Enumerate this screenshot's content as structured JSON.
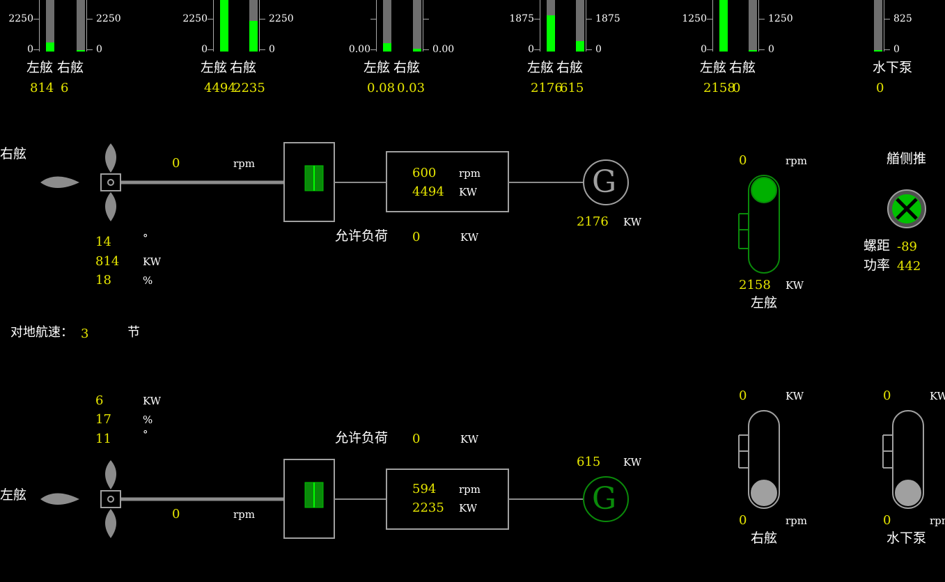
{
  "gauges": [
    {
      "left_tick_top": "2250",
      "left_tick_bottom": "0",
      "right_tick_top": "2250",
      "right_tick_bottom": "0",
      "bars": [
        {
          "label": "左舷",
          "value": "814",
          "fill": 0.18
        },
        {
          "label": "右舷",
          "value": "6",
          "fill": 0.01
        }
      ]
    },
    {
      "left_tick_top": "2250",
      "left_tick_bottom": "0",
      "right_tick_top": "2250",
      "right_tick_bottom": "0",
      "bars": [
        {
          "label": "左舷",
          "value": "4494",
          "fill": 1.0
        },
        {
          "label": "右舷",
          "value": "2235",
          "fill": 0.6
        }
      ]
    },
    {
      "left_tick_top": "",
      "left_tick_bottom": "0.00",
      "right_tick_top": "",
      "right_tick_bottom": "0.00",
      "bars": [
        {
          "label": "左舷",
          "value": "0.08",
          "fill": 0.16
        },
        {
          "label": "右舷",
          "value": "0.03",
          "fill": 0.06
        }
      ]
    },
    {
      "left_tick_top": "1875",
      "left_tick_bottom": "0",
      "right_tick_top": "1875",
      "right_tick_bottom": "0",
      "bars": [
        {
          "label": "左舷",
          "value": "2176",
          "fill": 0.7
        },
        {
          "label": "右舷",
          "value": "615",
          "fill": 0.2
        }
      ]
    },
    {
      "left_tick_top": "1250",
      "left_tick_bottom": "0",
      "right_tick_top": "1250",
      "right_tick_bottom": "0",
      "bars": [
        {
          "label": "左舷",
          "value": "2158",
          "fill": 1.0
        },
        {
          "label": "右舷",
          "value": "0",
          "fill": 0.01
        }
      ]
    },
    {
      "left_tick_top": "",
      "left_tick_bottom": "",
      "right_tick_top": "825",
      "right_tick_bottom": "0",
      "bars": [
        {
          "label": "水下泵",
          "value": "0",
          "fill": 0.01
        }
      ]
    }
  ],
  "starboard": {
    "side_label": "右舷",
    "shaft_rpm": "0",
    "shaft_rpm_unit": "rpm",
    "angle": "14",
    "angle_unit": "°",
    "power": "814",
    "power_unit": "KW",
    "percent": "18",
    "percent_unit": "%",
    "engine_rpm": "600",
    "engine_rpm_unit": "rpm",
    "engine_kw": "4494",
    "engine_kw_unit": "KW",
    "allowed_load_label": "允许负荷",
    "allowed_load": "0",
    "allowed_load_unit": "KW",
    "gen_kw": "2176",
    "gen_kw_unit": "KW",
    "gen_symbol": "G",
    "gen_color": "#a0a0a0"
  },
  "port": {
    "side_label": "左舷",
    "shaft_rpm": "0",
    "shaft_rpm_unit": "rpm",
    "power": "6",
    "power_unit": "KW",
    "percent": "17",
    "percent_unit": "%",
    "angle": "11",
    "angle_unit": "°",
    "engine_rpm": "594",
    "engine_rpm_unit": "rpm",
    "engine_kw": "2235",
    "engine_kw_unit": "KW",
    "allowed_load_label": "允许负荷",
    "allowed_load": "0",
    "allowed_load_unit": "KW",
    "gen_kw": "615",
    "gen_kw_unit": "KW",
    "gen_symbol": "G",
    "gen_color": "#0a8a0a"
  },
  "speed": {
    "label": "对地航速：",
    "value": "3",
    "unit": "节"
  },
  "motor_port": {
    "rpm": "0",
    "rpm_unit": "rpm",
    "kw": "2158",
    "kw_unit": "KW",
    "label": "左舷",
    "color": "#0a8a0a"
  },
  "bow_thruster": {
    "title": "艏侧推",
    "pitch_label": "螺距",
    "pitch": "-89",
    "power_label": "功率",
    "power": "442",
    "color": "#00c000"
  },
  "motor_starboard": {
    "kw": "0",
    "kw_unit": "KW",
    "rpm": "0",
    "rpm_unit": "rpm",
    "label": "右舷",
    "color": "#a0a0a0"
  },
  "motor_pump": {
    "kw": "0",
    "kw_unit": "KW",
    "rpm": "0",
    "rpm_unit": "rpm",
    "label": "水下泵",
    "color": "#a0a0a0"
  },
  "colors": {
    "bar_fill": "#00ff00",
    "bar_bg": "#6e6e6e",
    "value": "#e6e600",
    "line": "#8c8c8c"
  }
}
